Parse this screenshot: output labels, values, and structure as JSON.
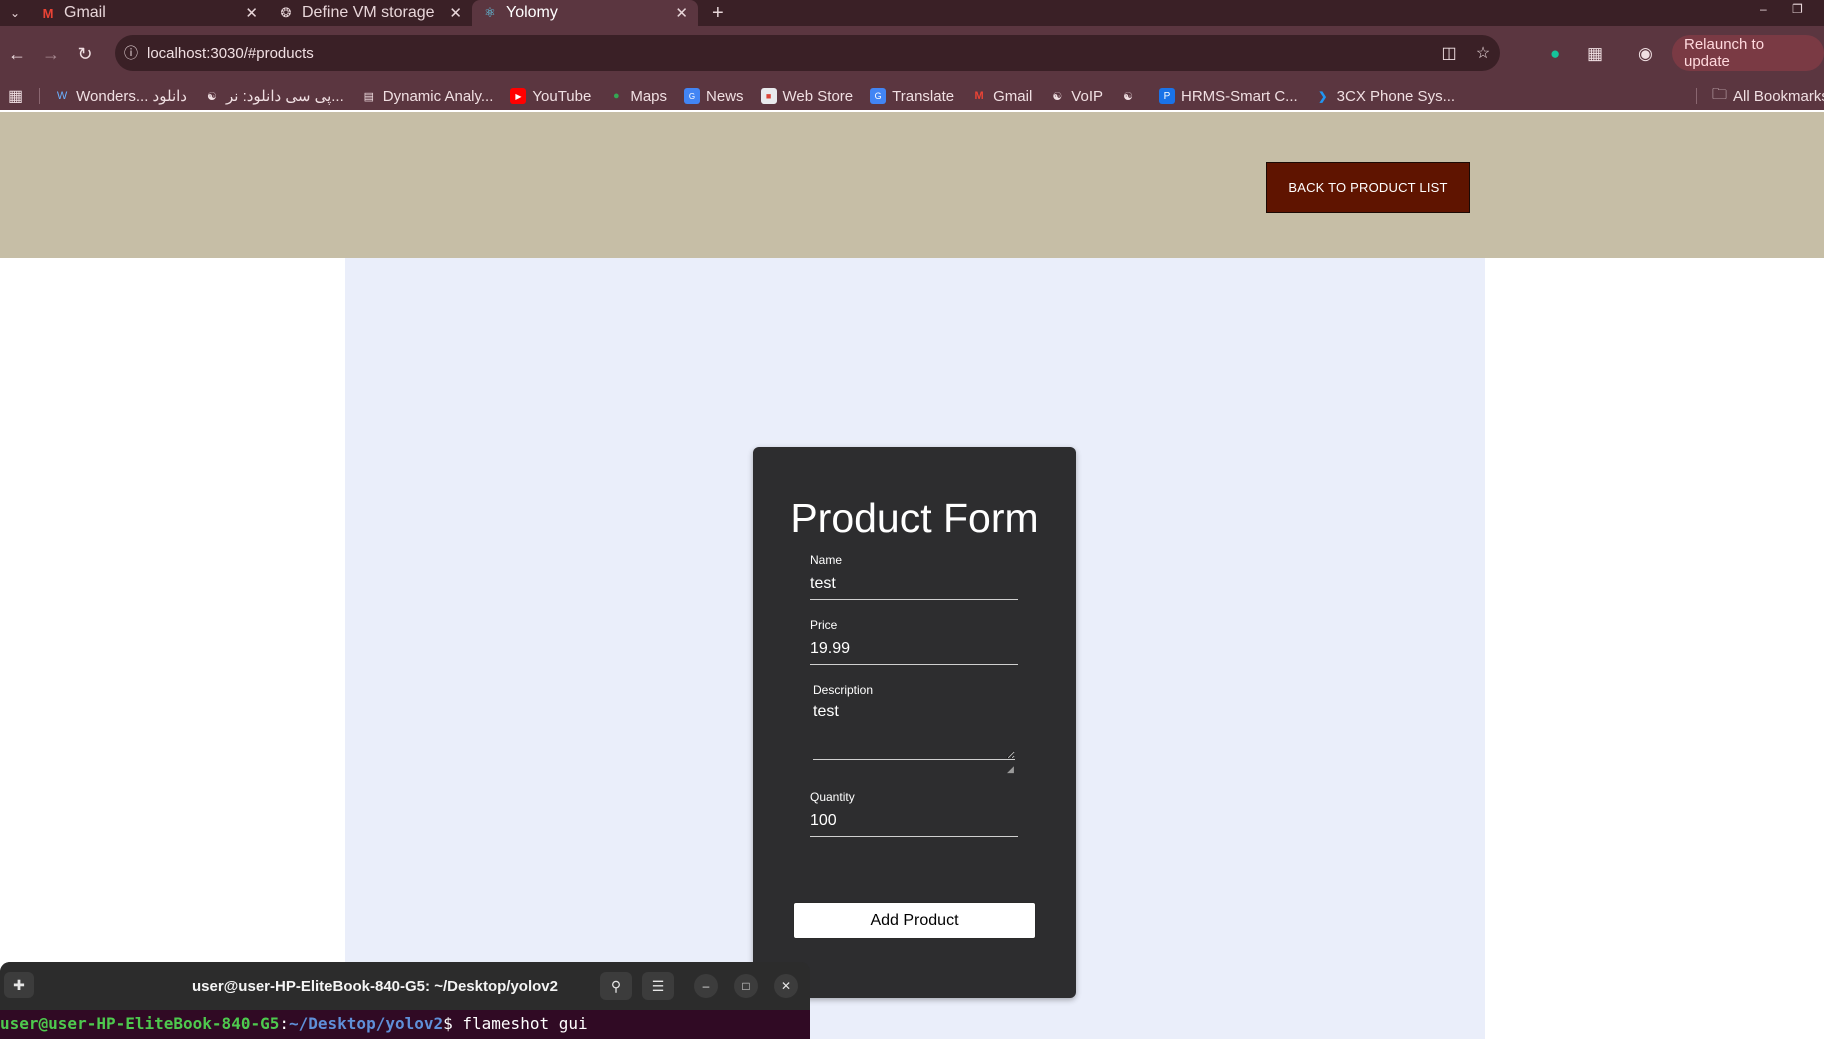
{
  "browser": {
    "tabs": [
      {
        "title": "Gmail",
        "icon": "gmail-icon"
      },
      {
        "title": "Define VM storage",
        "icon": "openai-icon"
      },
      {
        "title": "Yolomy",
        "icon": "react-icon",
        "active": true
      }
    ],
    "address": "localhost:3030/#products",
    "relaunch_label": "Relaunch to update",
    "bookmarks": [
      {
        "label": "Wonders... دانلود",
        "icon": "wordpress-icon"
      },
      {
        "label": "پی سی دانلود: نر...",
        "icon": "globe-icon"
      },
      {
        "label": "Dynamic Analy...",
        "icon": "document-icon"
      },
      {
        "label": "YouTube",
        "icon": "youtube-icon"
      },
      {
        "label": "Maps",
        "icon": "maps-icon"
      },
      {
        "label": "News",
        "icon": "news-icon"
      },
      {
        "label": "Web Store",
        "icon": "webstore-icon"
      },
      {
        "label": "Translate",
        "icon": "translate-icon"
      },
      {
        "label": "Gmail",
        "icon": "gmail-icon"
      },
      {
        "label": "VoIP",
        "icon": "globe-icon"
      },
      {
        "label": "",
        "icon": "globe-icon"
      },
      {
        "label": "HRMS-Smart C...",
        "icon": "hrms-icon"
      },
      {
        "label": "3CX Phone Sys...",
        "icon": "3cx-icon"
      }
    ],
    "all_bookmarks": "All Bookmarks"
  },
  "page": {
    "back_button": "BACK TO PRODUCT LIST",
    "form": {
      "title": "Product Form",
      "name_label": "Name",
      "name_value": "test",
      "price_label": "Price",
      "price_value": "19.99",
      "description_label": "Description",
      "description_value": "test",
      "quantity_label": "Quantity",
      "quantity_value": "100",
      "submit_label": "Add Product"
    }
  },
  "terminal": {
    "title": "user@user-HP-EliteBook-840-G5: ~/Desktop/yolov2",
    "prompt_user": "user@user-HP-EliteBook-840-G5",
    "prompt_sep": ":",
    "prompt_path": "~/Desktop/yolov2",
    "prompt_symbol": "$ ",
    "command": "flameshot gui"
  },
  "colors": {
    "header_bg": "#c6bea6",
    "main_bg": "#eaeefa",
    "card_bg": "#2d2d2f",
    "back_button_bg": "#5f1400",
    "browser_frame": "#5b3640"
  }
}
